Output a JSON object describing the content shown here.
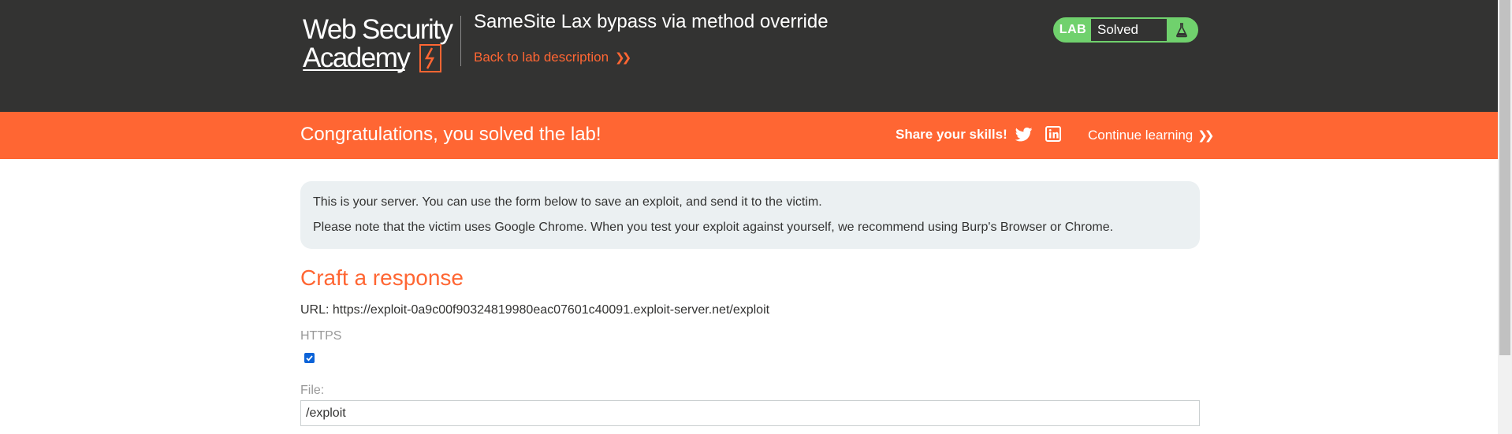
{
  "header": {
    "logo": {
      "line1": "Web Security",
      "line2": "Academy"
    },
    "lab_title": "SameSite Lax bypass via method override",
    "back_link": "Back to lab description",
    "lab_badge": {
      "tag": "LAB",
      "status": "Solved",
      "icon": "flask-icon"
    }
  },
  "notification": {
    "message": "Congratulations, you solved the lab!",
    "share_label": "Share your skills!",
    "share_icons": [
      "twitter-icon",
      "linkedin-icon"
    ],
    "continue_label": "Continue learning"
  },
  "info_box": {
    "line1": "This is your server. You can use the form below to save an exploit, and send it to the victim.",
    "line2": "Please note that the victim uses Google Chrome. When you test your exploit against yourself, we recommend using Burp's Browser or Chrome."
  },
  "form": {
    "title": "Craft a response",
    "url_line": "URL: https://exploit-0a9c00f90324819980eac07601c40091.exploit-server.net/exploit",
    "https_label": "HTTPS",
    "https_checked": true,
    "file_label": "File:",
    "file_value": "/exploit"
  },
  "colors": {
    "header_bg": "#333332",
    "accent_orange": "#ff6633",
    "solved_green": "#70d16d",
    "info_bg": "#ebf0f2"
  }
}
